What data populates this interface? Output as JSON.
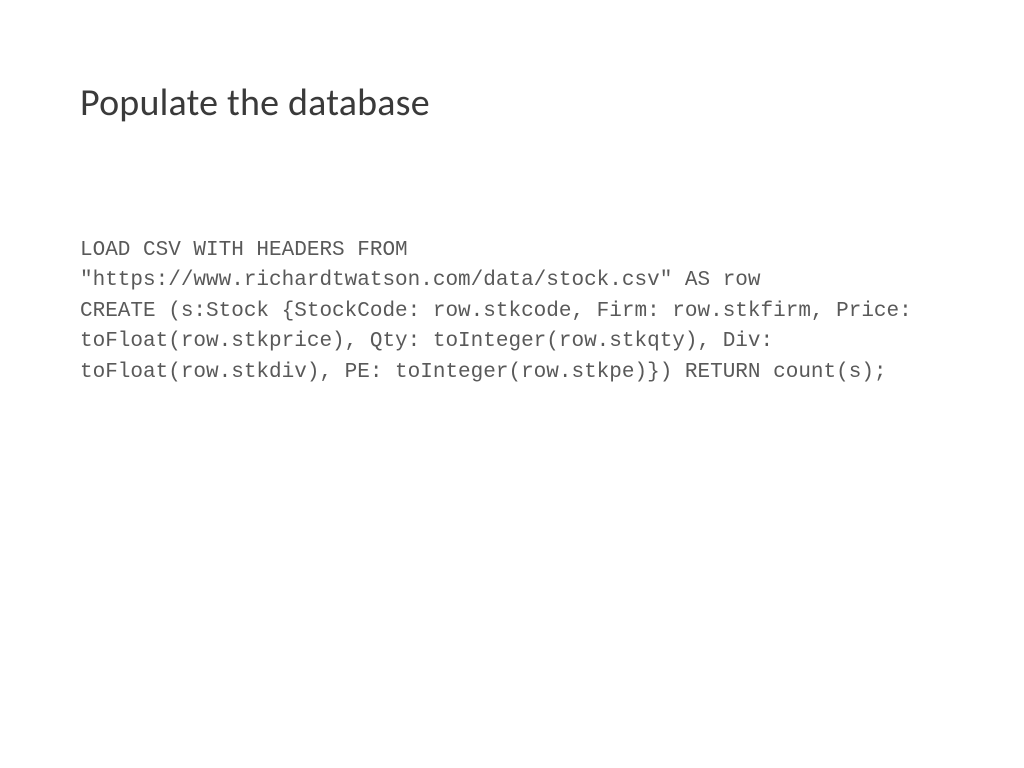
{
  "slide": {
    "title": "Populate the database",
    "code": "LOAD CSV WITH HEADERS FROM \"https://www.richardtwatson.com/data/stock.csv\" AS row\nCREATE (s:Stock {StockCode: row.stkcode, Firm: row.stkfirm, Price: toFloat(row.stkprice), Qty: toInteger(row.stkqty), Div: toFloat(row.stkdiv), PE: toInteger(row.stkpe)}) RETURN count(s);"
  }
}
